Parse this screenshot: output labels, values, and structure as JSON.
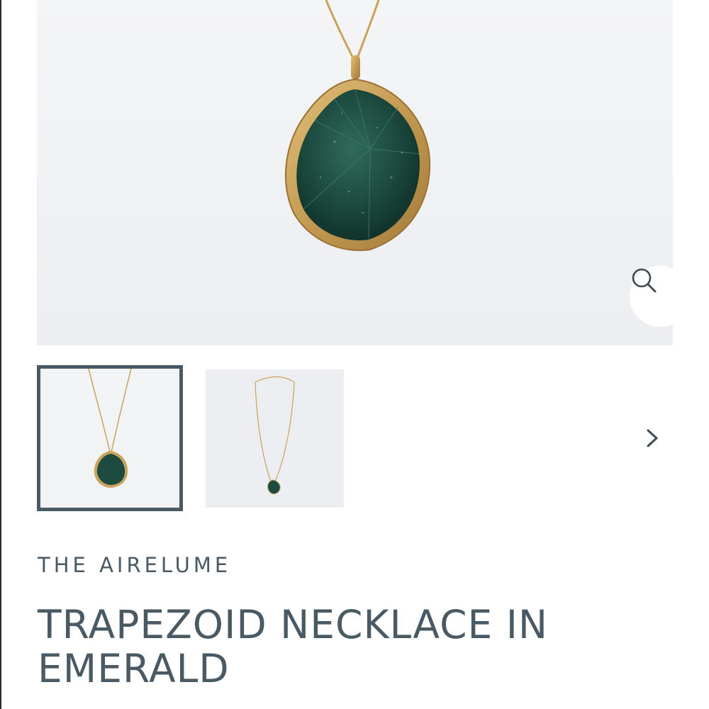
{
  "product": {
    "brand": "THE AIRELUME",
    "title": "TRAPEZOID NECKLACE IN EMERALD"
  },
  "gallery": {
    "main_image": "emerald-pendant-closeup",
    "thumbnails": [
      "emerald-pendant-closeup",
      "full-necklace-view"
    ],
    "selected_index": 0
  },
  "icons": {
    "zoom": "search-icon",
    "next": "chevron-right-icon"
  },
  "colors": {
    "text": "#4a5a64",
    "thumb_border": "#4a5a64",
    "gold": "#c9a25c",
    "emerald": "#1f4a40"
  }
}
